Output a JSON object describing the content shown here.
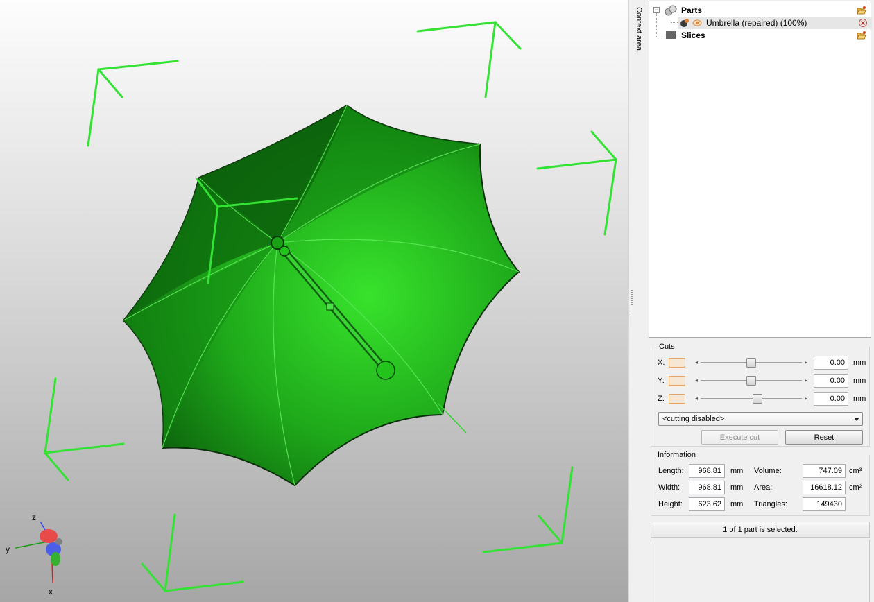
{
  "viewport": {
    "axes": {
      "z": "z",
      "y": "y",
      "x": "x"
    }
  },
  "context_area": {
    "label": "Context area"
  },
  "tree": {
    "parts_label": "Parts",
    "part_item_label": "Umbrella (repaired) (100%)",
    "slices_label": "Slices",
    "expander_glyph": "−"
  },
  "cuts": {
    "title": "Cuts",
    "rows": [
      {
        "axis": "X:",
        "value": "0.00",
        "unit": "mm",
        "level": 0.5
      },
      {
        "axis": "Y:",
        "value": "0.00",
        "unit": "mm",
        "level": 0.5
      },
      {
        "axis": "Z:",
        "value": "0.00",
        "unit": "mm",
        "level": 0.57
      }
    ],
    "mode": "<cutting disabled>",
    "execute_label": "Execute cut",
    "reset_label": "Reset"
  },
  "information": {
    "title": "Information",
    "length_label": "Length:",
    "length_value": "968.81",
    "length_unit": "mm",
    "width_label": "Width:",
    "width_value": "968.81",
    "width_unit": "mm",
    "height_label": "Height:",
    "height_value": "623.62",
    "height_unit": "mm",
    "volume_label": "Volume:",
    "volume_value": "747.09",
    "volume_unit": "cm³",
    "area_label": "Area:",
    "area_value": "16618.12",
    "area_unit": "cm²",
    "triangles_label": "Triangles:",
    "triangles_value": "149430"
  },
  "status": {
    "text": "1 of 1 part is selected."
  },
  "colors": {
    "umbrella_green": "#22c41c",
    "umbrella_dark": "#0e6d0e",
    "bounding_box": "#33e233",
    "swatch_border": "#e8a060"
  }
}
